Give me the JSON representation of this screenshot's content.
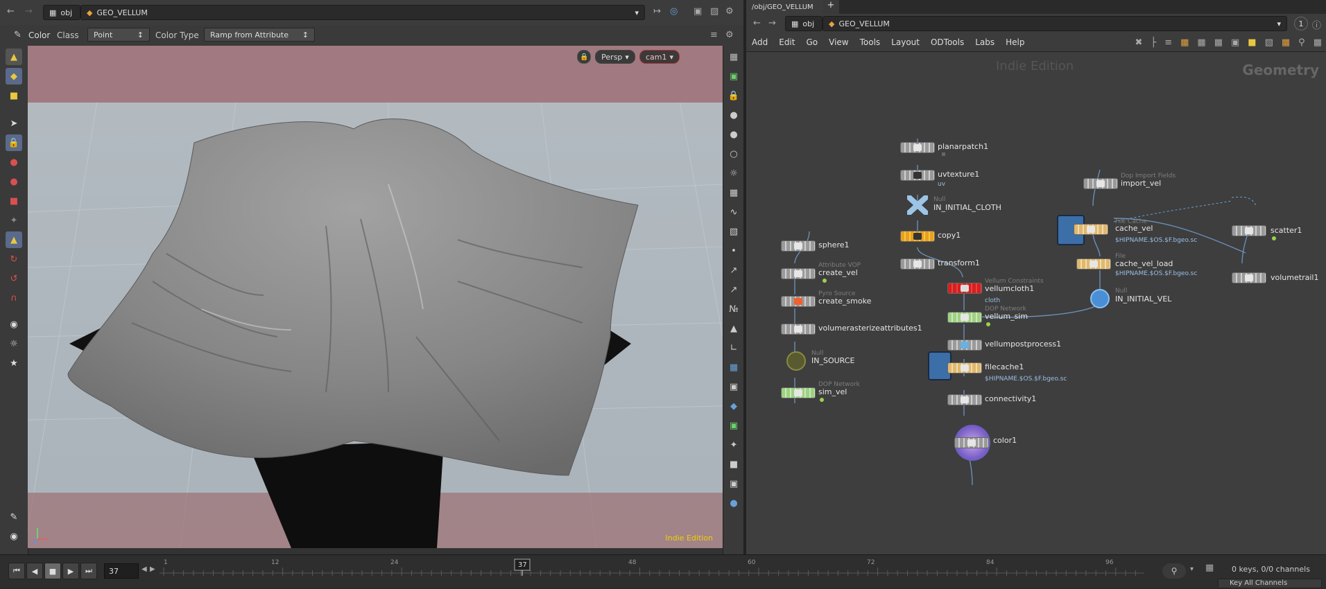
{
  "left_pane": {
    "path": {
      "root": "obj",
      "node": "GEO_VELLUM"
    },
    "options": {
      "color_label": "Color",
      "class_label": "Class",
      "class_value": "Point",
      "color_type_label": "Color Type",
      "color_type_value": "Ramp from Attribute"
    },
    "viewport": {
      "camera_menu": "Persp",
      "camera_name": "cam1",
      "watermark": "Indie Edition"
    }
  },
  "right_pane": {
    "tab_label": "/obj/GEO_VELLUM",
    "path": {
      "root": "obj",
      "node": "GEO_VELLUM"
    },
    "indicator": "1",
    "menu": [
      "Add",
      "Edit",
      "Go",
      "View",
      "Tools",
      "Layout",
      "ODTools",
      "Labs",
      "Help"
    ],
    "network": {
      "edition": "Indie Edition",
      "context": "Geometry",
      "nodes": [
        {
          "name": "planarpatch1",
          "type": "",
          "sub": ""
        },
        {
          "name": "uvtexture1",
          "type": "",
          "sub": "uv"
        },
        {
          "name": "IN_INITIAL_CLOTH",
          "type": "Null",
          "sub": ""
        },
        {
          "name": "copy1",
          "type": "",
          "sub": ""
        },
        {
          "name": "transform1",
          "type": "",
          "sub": ""
        },
        {
          "name": "vellumcloth1",
          "type": "Vellum Constraints",
          "sub": "cloth"
        },
        {
          "name": "vellum_sim",
          "type": "DOP Network",
          "sub": ""
        },
        {
          "name": "vellumpostprocess1",
          "type": "",
          "sub": ""
        },
        {
          "name": "filecache1",
          "type": "",
          "sub": "$HIPNAME.$OS.$F.bgeo.sc"
        },
        {
          "name": "connectivity1",
          "type": "",
          "sub": ""
        },
        {
          "name": "color1",
          "type": "",
          "sub": ""
        },
        {
          "name": "sphere1",
          "type": "",
          "sub": ""
        },
        {
          "name": "create_vel",
          "type": "Attribute VOP",
          "sub": ""
        },
        {
          "name": "create_smoke",
          "type": "Pyro Source",
          "sub": ""
        },
        {
          "name": "volumerasterizeattributes1",
          "type": "",
          "sub": ""
        },
        {
          "name": "IN_SOURCE",
          "type": "Null",
          "sub": ""
        },
        {
          "name": "sim_vel",
          "type": "DOP Network",
          "sub": ""
        },
        {
          "name": "import_vel",
          "type": "Dop Import Fields",
          "sub": ""
        },
        {
          "name": "cache_vel",
          "type": "File Cache",
          "sub": "$HIPNAME.$OS.$F.bgeo.sc"
        },
        {
          "name": "cache_vel_load",
          "type": "File",
          "sub": "$HIPNAME.$OS.$F.bgeo.sc"
        },
        {
          "name": "IN_INITIAL_VEL",
          "type": "Null",
          "sub": ""
        },
        {
          "name": "scatter1",
          "type": "",
          "sub": ""
        },
        {
          "name": "volumetrail1",
          "type": "",
          "sub": ""
        }
      ]
    }
  },
  "timeline": {
    "current_frame": "37",
    "frame_marker": "37",
    "ticks": [
      "1",
      "12",
      "24",
      "36",
      "48",
      "60",
      "72",
      "84",
      "96"
    ],
    "keys_info": "0 keys, 0/0 channels",
    "key_all_channels": "Key All Channels"
  },
  "colors": {
    "accent_yellow": "#e8c840",
    "bypass_red": "#d42020",
    "dop_green": "#a6d88a",
    "filecache_tan": "#e8c880",
    "null_blue": "#4a8fd6",
    "wire": "#6aa0d8"
  }
}
